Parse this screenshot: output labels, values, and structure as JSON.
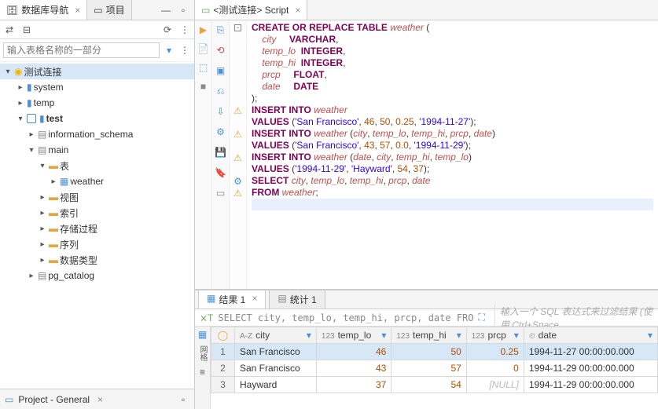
{
  "left": {
    "tabs": [
      {
        "label": "数据库导航",
        "active": true
      },
      {
        "label": "项目",
        "active": false
      }
    ],
    "search_placeholder": "输入表格名称的一部分",
    "connection": "测试连接",
    "tree": {
      "system": "system",
      "temp": "temp",
      "test": "test",
      "info_schema": "information_schema",
      "main": "main",
      "tables": "表",
      "weather": "weather",
      "views": "视图",
      "indexes": "索引",
      "procedures": "存储过程",
      "sequences": "序列",
      "datatypes": "数据类型",
      "pg_catalog": "pg_catalog"
    },
    "bottom_tab": "Project - General"
  },
  "editor": {
    "tab": "<测试连接> Script",
    "code_lines": [
      {
        "fold": true,
        "tokens": [
          [
            "kw",
            "CREATE OR REPLACE TABLE"
          ],
          [
            "",
            " "
          ],
          [
            "name",
            "weather"
          ],
          [
            "",
            " ("
          ]
        ]
      },
      {
        "tokens": [
          [
            "",
            "    "
          ],
          [
            "name",
            "city"
          ],
          [
            "",
            "     "
          ],
          [
            "type",
            "VARCHAR"
          ],
          [
            "",
            ","
          ]
        ]
      },
      {
        "tokens": [
          [
            "",
            "    "
          ],
          [
            "name",
            "temp_lo"
          ],
          [
            "",
            "  "
          ],
          [
            "type",
            "INTEGER"
          ],
          [
            "",
            ","
          ]
        ]
      },
      {
        "tokens": [
          [
            "",
            "    "
          ],
          [
            "name",
            "temp_hi"
          ],
          [
            "",
            "  "
          ],
          [
            "type",
            "INTEGER"
          ],
          [
            "",
            ","
          ]
        ]
      },
      {
        "tokens": [
          [
            "",
            "    "
          ],
          [
            "name",
            "prcp"
          ],
          [
            "",
            "     "
          ],
          [
            "type",
            "FLOAT"
          ],
          [
            "",
            ","
          ]
        ]
      },
      {
        "tokens": [
          [
            "",
            "    "
          ],
          [
            "name",
            "date"
          ],
          [
            "",
            "     "
          ],
          [
            "type",
            "DATE"
          ]
        ]
      },
      {
        "tokens": [
          [
            "",
            ");"
          ]
        ]
      },
      {
        "warn": true,
        "fold": true,
        "tokens": [
          [
            "kw",
            "INSERT INTO"
          ],
          [
            "",
            " "
          ],
          [
            "name",
            "weather"
          ]
        ]
      },
      {
        "tokens": [
          [
            "kw",
            "VALUES"
          ],
          [
            "",
            " ("
          ],
          [
            "str",
            "'San Francisco'"
          ],
          [
            "",
            ", "
          ],
          [
            "num",
            "46"
          ],
          [
            "",
            ", "
          ],
          [
            "num",
            "50"
          ],
          [
            "",
            ", "
          ],
          [
            "num",
            "0.25"
          ],
          [
            "",
            ", "
          ],
          [
            "str",
            "'1994-11-27'"
          ],
          [
            "",
            ");"
          ]
        ]
      },
      {
        "warn": true,
        "fold": true,
        "tokens": [
          [
            "kw",
            "INSERT INTO"
          ],
          [
            "",
            " "
          ],
          [
            "name",
            "weather"
          ],
          [
            "",
            " ("
          ],
          [
            "name",
            "city"
          ],
          [
            "",
            ", "
          ],
          [
            "name",
            "temp_lo"
          ],
          [
            "",
            ", "
          ],
          [
            "name",
            "temp_hi"
          ],
          [
            "",
            ", "
          ],
          [
            "name",
            "prcp"
          ],
          [
            "",
            ", "
          ],
          [
            "name",
            "date"
          ],
          [
            "",
            ")"
          ]
        ]
      },
      {
        "tokens": [
          [
            "kw",
            "VALUES"
          ],
          [
            "",
            " ("
          ],
          [
            "str",
            "'San Francisco'"
          ],
          [
            "",
            ", "
          ],
          [
            "num",
            "43"
          ],
          [
            "",
            ", "
          ],
          [
            "num",
            "57"
          ],
          [
            "",
            ", "
          ],
          [
            "num",
            "0.0"
          ],
          [
            "",
            ", "
          ],
          [
            "str",
            "'1994-11-29'"
          ],
          [
            "",
            ");"
          ]
        ]
      },
      {
        "warn": true,
        "fold": true,
        "tokens": [
          [
            "kw",
            "INSERT INTO"
          ],
          [
            "",
            " "
          ],
          [
            "name",
            "weather"
          ],
          [
            "",
            " ("
          ],
          [
            "name",
            "date"
          ],
          [
            "",
            ", "
          ],
          [
            "name",
            "city"
          ],
          [
            "",
            ", "
          ],
          [
            "name",
            "temp_hi"
          ],
          [
            "",
            ", "
          ],
          [
            "name",
            "temp_lo"
          ],
          [
            "",
            ")"
          ]
        ]
      },
      {
        "tokens": [
          [
            "kw",
            "VALUES"
          ],
          [
            "",
            " ("
          ],
          [
            "str",
            "'1994-11-29'"
          ],
          [
            "",
            ", "
          ],
          [
            "str",
            "'Hayward'"
          ],
          [
            "",
            ", "
          ],
          [
            "num",
            "54"
          ],
          [
            "",
            ", "
          ],
          [
            "num",
            "37"
          ],
          [
            "",
            ");"
          ]
        ]
      },
      {
        "cog": true,
        "fold": true,
        "tokens": [
          [
            "kw",
            "SELECT"
          ],
          [
            "",
            " "
          ],
          [
            "name",
            "city"
          ],
          [
            "",
            ", "
          ],
          [
            "name",
            "temp_lo"
          ],
          [
            "",
            ", "
          ],
          [
            "name",
            "temp_hi"
          ],
          [
            "",
            ", "
          ],
          [
            "name",
            "prcp"
          ],
          [
            "",
            ", "
          ],
          [
            "name",
            "date"
          ]
        ]
      },
      {
        "warn": true,
        "tokens": [
          [
            "kw",
            "FROM"
          ],
          [
            "",
            " "
          ],
          [
            "name",
            "weather"
          ],
          [
            "",
            ";"
          ]
        ]
      },
      {
        "cursor": true,
        "tokens": [
          [
            "",
            ""
          ]
        ]
      }
    ]
  },
  "results": {
    "tabs": [
      {
        "label": "结果 1",
        "active": true
      },
      {
        "label": "统计 1",
        "active": false
      }
    ],
    "query_echo": "SELECT city, temp_lo, temp_hi, prcp, date FRO",
    "filter_placeholder": "输入一个 SQL 表达式来过滤结果 (使用 Ctrl+Space",
    "columns": [
      {
        "label": "city",
        "type": "A-Z"
      },
      {
        "label": "temp_lo",
        "type": "123"
      },
      {
        "label": "temp_hi",
        "type": "123"
      },
      {
        "label": "prcp",
        "type": "123"
      },
      {
        "label": "date",
        "type": "⏲"
      }
    ],
    "rows": [
      {
        "n": 1,
        "city": "San Francisco",
        "temp_lo": "46",
        "temp_hi": "50",
        "prcp": "0.25",
        "date": "1994-11-27 00:00:00.000",
        "sel": true
      },
      {
        "n": 2,
        "city": "San Francisco",
        "temp_lo": "43",
        "temp_hi": "57",
        "prcp": "0",
        "date": "1994-11-29 00:00:00.000",
        "sel": false
      },
      {
        "n": 3,
        "city": "Hayward",
        "temp_lo": "37",
        "temp_hi": "54",
        "prcp": "[NULL]",
        "date": "1994-11-29 00:00:00.000",
        "sel": false
      }
    ]
  }
}
